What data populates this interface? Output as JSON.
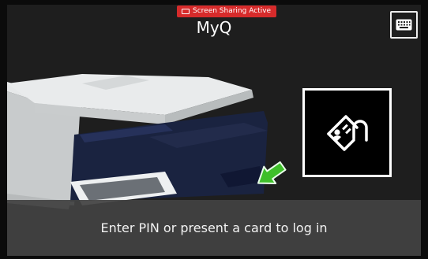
{
  "app_title": "MyQ",
  "status_badge": {
    "label": "Screen Sharing Active",
    "color": "#d62b2b"
  },
  "keyboard_button": {
    "icon": "keyboard-icon"
  },
  "login_prompt": "Enter PIN or present a card to log in",
  "card_icon": "card-reader-icon",
  "colors": {
    "background": "#1e1e1e",
    "arrow": "#3fbf2a",
    "banner": "#424242"
  }
}
